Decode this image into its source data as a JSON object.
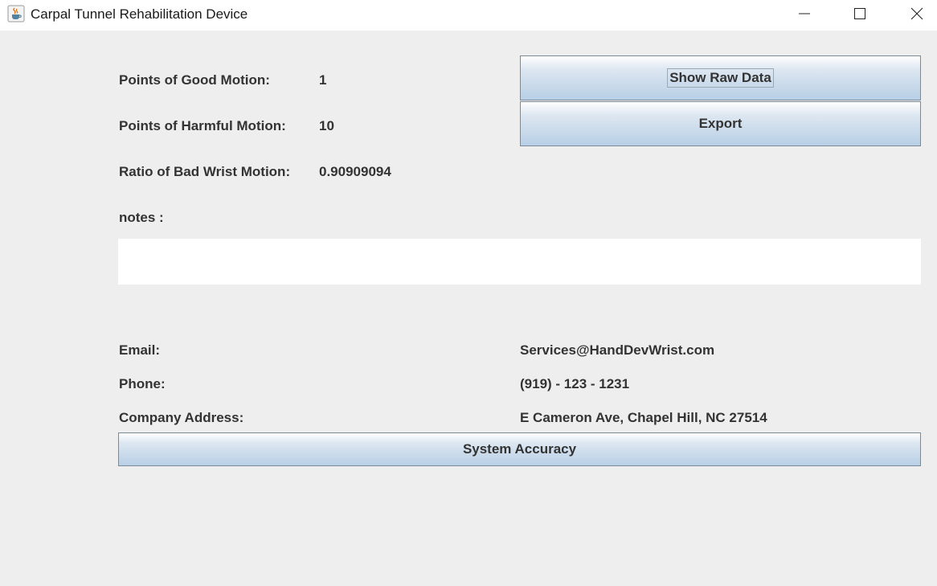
{
  "window": {
    "title": "Carpal Tunnel Rehabilitation Device"
  },
  "stats": {
    "good_motion_label": "Points of Good Motion:",
    "good_motion_value": "1",
    "harmful_motion_label": "Points of Harmful Motion:",
    "harmful_motion_value": "10",
    "ratio_label": "Ratio of Bad Wrist Motion:",
    "ratio_value": "0.90909094"
  },
  "buttons": {
    "show_raw_data": "Show Raw Data",
    "export": "Export",
    "system_accuracy": "System Accuracy"
  },
  "notes": {
    "label": "notes :",
    "value": ""
  },
  "contact": {
    "email_label": "Email:",
    "email_value": "Services@HandDevWrist.com",
    "phone_label": "Phone:",
    "phone_value": "(919) - 123 - 1231",
    "address_label": "Company Address:",
    "address_value": "E Cameron Ave, Chapel Hill, NC 27514"
  },
  "icons": {
    "app": "java-coffee-cup-icon",
    "minimize": "minimize-icon",
    "maximize": "maximize-icon",
    "close": "close-icon"
  }
}
